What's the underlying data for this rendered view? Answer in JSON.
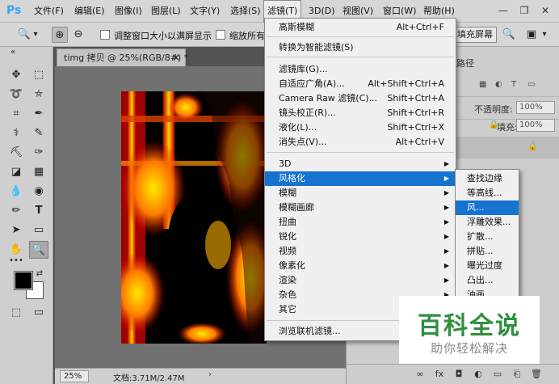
{
  "menubar": {
    "logo": "Ps",
    "items": [
      "文件(F)",
      "编辑(E)",
      "图像(I)",
      "图层(L)",
      "文字(Y)",
      "选择(S)",
      "滤镜(T)",
      "3D(D)",
      "视图(V)",
      "窗口(W)",
      "帮助(H)"
    ],
    "minimize": "—",
    "restore": "❐",
    "close": "✕"
  },
  "options": {
    "zoom_tool_icon": "🔍",
    "dropdown_arrow": "▾",
    "zoom_in": "⊕",
    "zoom_out": "⊖",
    "resize_windows_label": "调整窗口大小以满屏显示",
    "zoom_all_label": "缩放所有",
    "fill_screen": "填充屏幕",
    "search_icon": "🔍",
    "workspace_icon": "▣",
    "workspace_arrow": "▾"
  },
  "tools": {
    "collapse": "«",
    "glyphs": [
      "✥",
      "⬚",
      "➰",
      "⛤",
      "⌗",
      "✒",
      "⚕",
      "✎",
      "⛏",
      "✑",
      "◪",
      "▦",
      "⌫",
      "▥",
      "💧",
      "◉",
      "✏",
      "T",
      "➤",
      "▭",
      "✋",
      "🔍",
      "•••"
    ],
    "swap": "⇄",
    "mask_icon": "⬚",
    "screen_icon": "▭"
  },
  "document": {
    "tab_title": "timg 拷贝 @ 25%(RGB/8#) *",
    "tab_close": "×",
    "zoom": "25%",
    "doc_info": "文档:3.71M/2.47M",
    "arrow": "›"
  },
  "panel": {
    "tab_label": "路径",
    "opacity_label": "不透明度:",
    "opacity_value": "100%",
    "fill_label": "填充:",
    "fill_value": "100%",
    "lock_icon": "🔒",
    "bottom_icons": [
      "∞",
      "fx",
      "◘",
      "◐",
      "▭",
      "⎗",
      "🗑"
    ]
  },
  "filter_menu": {
    "items": [
      {
        "label": "高斯模糊",
        "shortcut": "Alt+Ctrl+F"
      },
      {
        "label": "转换为智能滤镜(S)",
        "shortcut": ""
      },
      {
        "label": "滤镜库(G)...",
        "shortcut": ""
      },
      {
        "label": "自适应广角(A)...",
        "shortcut": "Alt+Shift+Ctrl+A"
      },
      {
        "label": "Camera Raw 滤镜(C)...",
        "shortcut": "Shift+Ctrl+A"
      },
      {
        "label": "镜头校正(R)...",
        "shortcut": "Shift+Ctrl+R"
      },
      {
        "label": "液化(L)...",
        "shortcut": "Shift+Ctrl+X"
      },
      {
        "label": "消失点(V)...",
        "shortcut": "Alt+Ctrl+V"
      },
      {
        "label": "3D",
        "shortcut": ""
      },
      {
        "label": "风格化",
        "shortcut": ""
      },
      {
        "label": "模糊",
        "shortcut": ""
      },
      {
        "label": "模糊画廊",
        "shortcut": ""
      },
      {
        "label": "扭曲",
        "shortcut": ""
      },
      {
        "label": "锐化",
        "shortcut": ""
      },
      {
        "label": "视频",
        "shortcut": ""
      },
      {
        "label": "像素化",
        "shortcut": ""
      },
      {
        "label": "渲染",
        "shortcut": ""
      },
      {
        "label": "杂色",
        "shortcut": ""
      },
      {
        "label": "其它",
        "shortcut": ""
      },
      {
        "label": "浏览联机滤镜...",
        "shortcut": ""
      }
    ],
    "submenu_arrow": "▶"
  },
  "stylize_submenu": {
    "items": [
      "查找边缘",
      "等高线...",
      "风...",
      "浮雕效果...",
      "扩散...",
      "拼贴...",
      "曝光过度",
      "凸出...",
      "油画"
    ]
  },
  "watermark": {
    "title": "百科全说",
    "subtitle": "助你轻松解决"
  }
}
